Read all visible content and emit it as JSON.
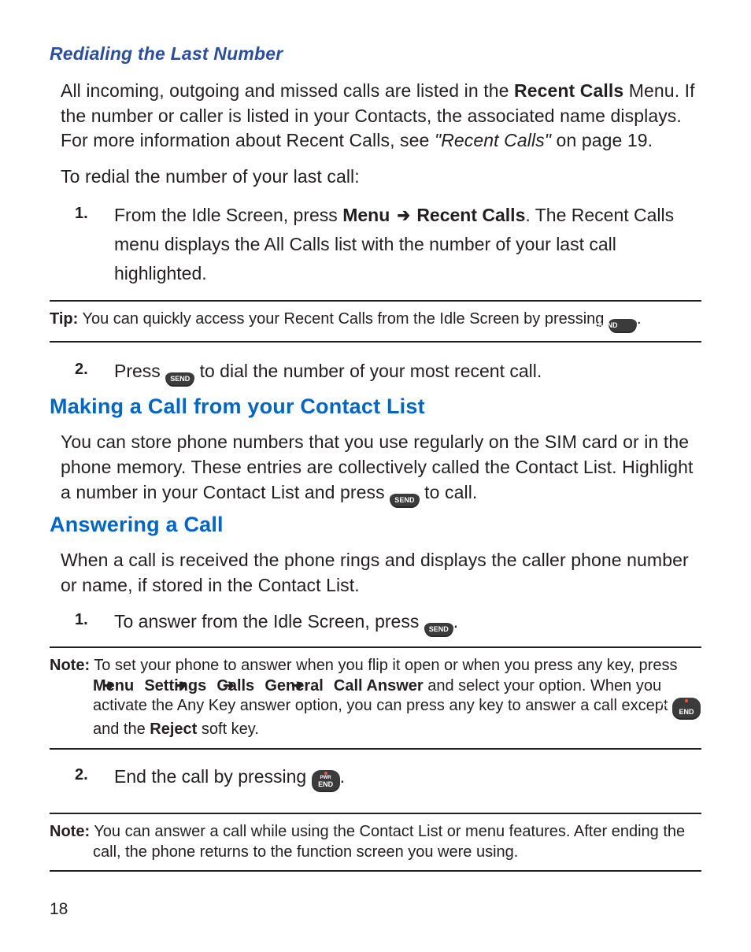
{
  "subsection": {
    "heading": "Redialing the Last Number"
  },
  "para1": {
    "pre": "All incoming, outgoing and missed calls are listed in the ",
    "bold1": "Recent Calls",
    "mid": " Menu. If the number or caller is listed in your Contacts, the associated name displays. For more information about Recent Calls, see ",
    "ref": "\"Recent Calls\"",
    "post": " on page 19."
  },
  "para2": "To redial the number of your last call:",
  "redial": {
    "n1": "1.",
    "item1_pre": "From the Idle Screen, press ",
    "item1_b1": "Menu",
    "item1_arrow": "➔",
    "item1_b2": "Recent Calls",
    "item1_post": ". The Recent Calls menu displays the All Calls list with the number of your last call highlighted.",
    "n2": "2.",
    "item2_pre": "Press ",
    "item2_post": " to dial the number of your most recent call."
  },
  "tip": {
    "lead": "Tip:",
    "text": " You can quickly access your Recent Calls from the Idle Screen by pressing ",
    "end": "."
  },
  "sections": {
    "makingCall": "Making a Call from your Contact List",
    "answering": "Answering a Call"
  },
  "contactListPara": {
    "pre": "You can store phone numbers that you use regularly on the SIM card or in the phone memory. These entries are collectively called the Contact List. Highlight a number in your Contact List and press ",
    "post": " to call."
  },
  "answerPara": "When a call is received the phone rings and displays the caller phone number or name, if stored in the Contact List.",
  "answer": {
    "n1": "1.",
    "item1_pre": "To answer from the Idle Screen, press ",
    "item1_post": ".",
    "n2": "2.",
    "item2_pre": "End the call by pressing ",
    "item2_post": "."
  },
  "note1": {
    "lead": "Note:",
    "pre": " To set your phone to answer when you flip it open or when you press any key, press ",
    "path_menu": "Menu",
    "arrow": "➔",
    "path_settings": "Settings",
    "path_calls": "Calls",
    "path_general": "General",
    "path_answer": "Call Answer",
    "mid": " and select your option. When you activate the Any Key answer option, you can press any key to answer a call except ",
    "after_key": " and the ",
    "reject": "Reject",
    "end": " soft key."
  },
  "note2": {
    "lead": "Note:",
    "text": " You can answer a call while using the Contact List or menu features. After ending the call, the phone returns to the function screen you were using."
  },
  "keys": {
    "send": "SEND",
    "pwr": "PWR",
    "end": "END"
  },
  "pageNumber": "18"
}
